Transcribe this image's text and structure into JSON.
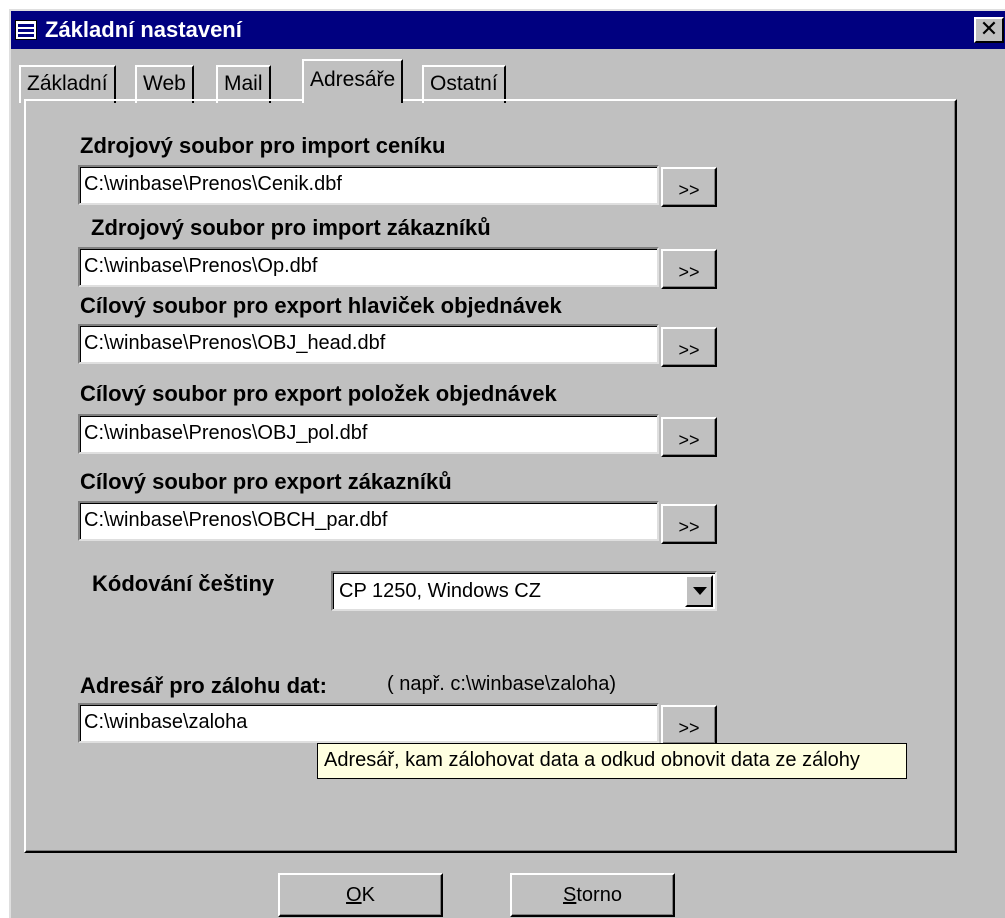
{
  "window": {
    "title": "Základní nastavení",
    "close_label": "✕"
  },
  "tabs": [
    {
      "label": "Základní",
      "active": false
    },
    {
      "label": "Web",
      "active": false
    },
    {
      "label": "Mail",
      "active": false
    },
    {
      "label": "Adresáře",
      "active": true
    },
    {
      "label": "Ostatní",
      "active": false
    }
  ],
  "fields": [
    {
      "label": "Zdrojový soubor pro import ceníku",
      "value": "C:\\winbase\\Prenos\\Cenik.dbf",
      "button": ">>"
    },
    {
      "label": "Zdrojový soubor pro import zákazníků",
      "value": "C:\\winbase\\Prenos\\Op.dbf",
      "button": ">>"
    },
    {
      "label": "Cílový soubor pro export hlaviček objednávek",
      "value": "C:\\winbase\\Prenos\\OBJ_head.dbf",
      "button": ">>"
    },
    {
      "label": "Cílový soubor pro export položek objednávek",
      "value": "C:\\winbase\\Prenos\\OBJ_pol.dbf",
      "button": ">>"
    },
    {
      "label": "Cílový soubor pro export zákazníků",
      "value": "C:\\winbase\\Prenos\\OBCH_par.dbf",
      "button": ">>"
    }
  ],
  "encoding": {
    "label": "Kódování češtiny",
    "value": "CP 1250, Windows CZ"
  },
  "backup": {
    "label": "Adresář pro zálohu dat:",
    "hint": "( např. c:\\winbase\\zaloha)",
    "value": "C:\\winbase\\zaloha",
    "button": ">>",
    "tooltip": "Adresář, kam zálohovat data a odkud obnovit data ze zálohy"
  },
  "buttons": {
    "ok_accel": "O",
    "ok_rest": "K",
    "cancel_accel": "S",
    "cancel_rest": "torno"
  }
}
